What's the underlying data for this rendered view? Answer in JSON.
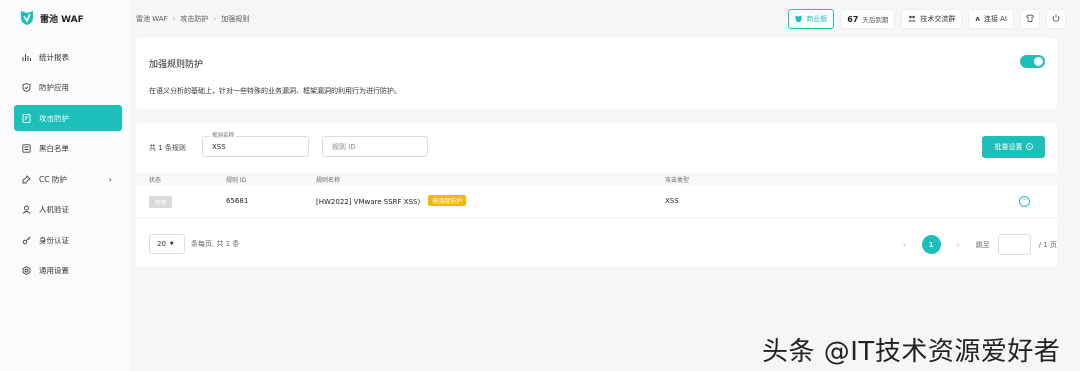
{
  "app": {
    "name": "雷池 WAF"
  },
  "sidebar": {
    "items": [
      {
        "label": "统计报表",
        "icon": "bar-chart-icon"
      },
      {
        "label": "防护应用",
        "icon": "shield-icon"
      },
      {
        "label": "攻击防护",
        "icon": "document-shield-icon",
        "active": true
      },
      {
        "label": "黑白名单",
        "icon": "list-icon"
      },
      {
        "label": "CC 防护",
        "icon": "pin-icon",
        "chevron": "›"
      },
      {
        "label": "人机验证",
        "icon": "user-icon"
      },
      {
        "label": "身份认证",
        "icon": "key-icon"
      },
      {
        "label": "通用设置",
        "icon": "settings-icon"
      }
    ]
  },
  "header": {
    "breadcrumb": [
      "雷池 WAF",
      "攻击防护",
      "加强规则"
    ],
    "edition": "商业版",
    "days_num": "67",
    "days_label": "天后到期",
    "community": "技术交流群",
    "ai": "连接 AI"
  },
  "rule_card": {
    "title": "加强规则防护",
    "description": "在语义分析的基础上，针对一些特殊的业务漏洞、框架漏洞的利用行为进行防护。",
    "enabled": true
  },
  "rules": {
    "count_text": "共 1 条规则",
    "name_filter": {
      "label": "规则名称",
      "value": "XSS"
    },
    "id_filter": {
      "placeholder": "规则 ID"
    },
    "batch_button": "批量设置",
    "columns": [
      "状态",
      "规则 ID",
      "规则名称",
      "攻击类型"
    ],
    "rows": [
      {
        "status": "禁用",
        "id": "65681",
        "name": "[HW2022] VMware SSRF XSS)",
        "tag": "高强度防护",
        "type": "XSS"
      }
    ]
  },
  "pagination": {
    "page_size": "20",
    "info": "条每页, 共 1 条",
    "current": "1",
    "jump_label": "跳至",
    "total_pages": "/ 1 页"
  },
  "colors": {
    "accent": "#1cbfba",
    "tag": "#f5b800"
  },
  "watermark": "头条 @IT技术资源爱好者"
}
